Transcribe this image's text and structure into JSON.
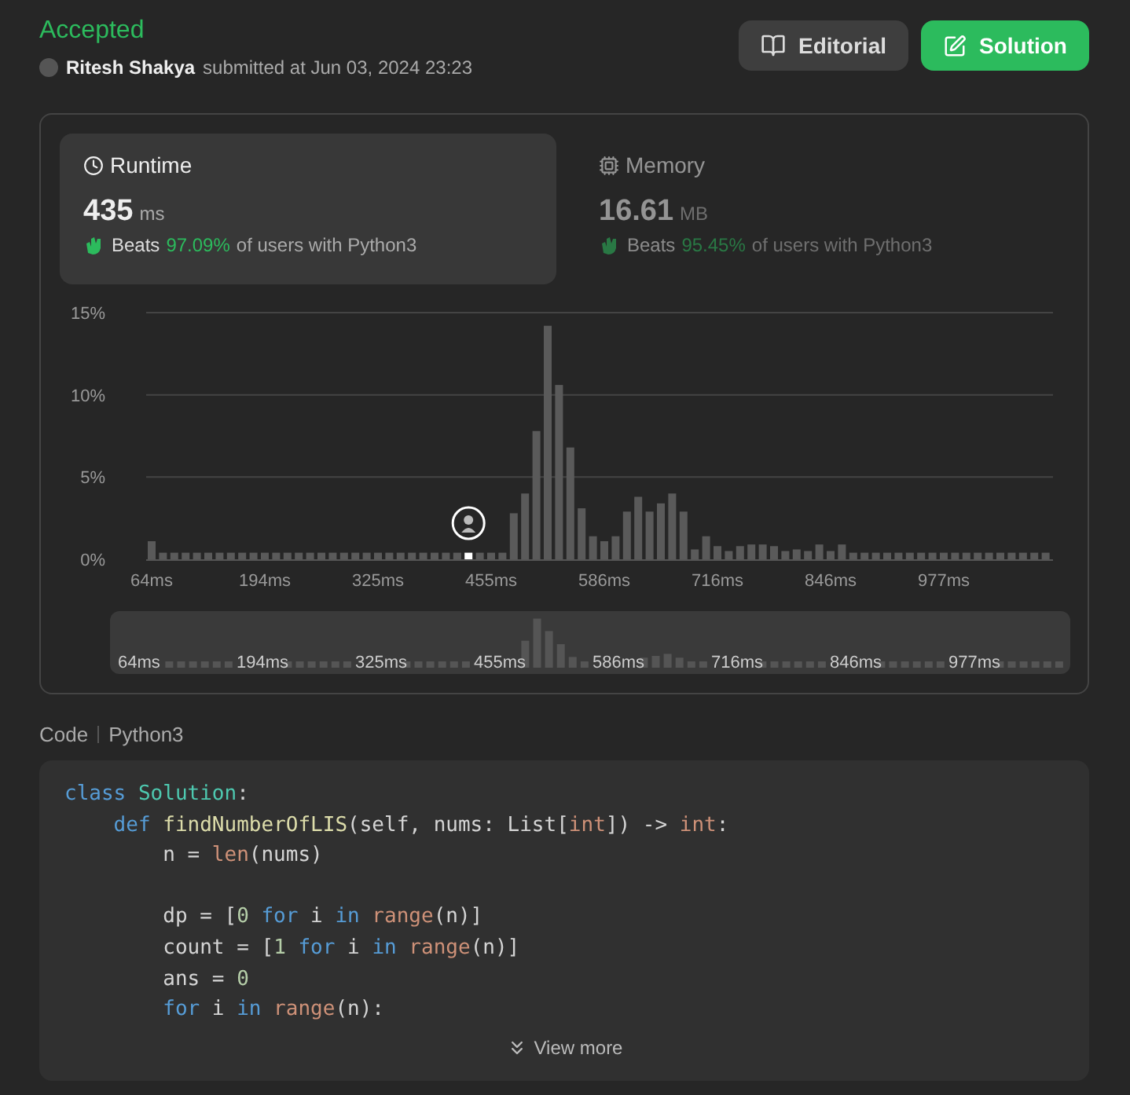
{
  "status": "Accepted",
  "submission": {
    "user": "Ritesh Shakya",
    "submitted": "submitted at Jun 03, 2024 23:23"
  },
  "buttons": [
    {
      "label": "Editorial",
      "kind": "secondary"
    },
    {
      "label": "Solution",
      "kind": "primary"
    }
  ],
  "stats": [
    {
      "title": "Runtime",
      "kind": "clock",
      "value": "435",
      "unit": "ms",
      "beats_label": "Beats",
      "beats": "97.09%",
      "suffix": "of users with Python3",
      "selected": true
    },
    {
      "title": "Memory",
      "kind": "chip",
      "value": "16.61",
      "unit": "MB",
      "beats_label": "Beats",
      "beats": "95.45%",
      "suffix": "of users with Python3",
      "selected": false
    }
  ],
  "chart": {
    "chart_data": {
      "type": "bar",
      "ylim": [
        0,
        15
      ],
      "yticks": [
        {
          "value": 0,
          "label": "0%"
        },
        {
          "value": 5,
          "label": "5%"
        },
        {
          "value": 10,
          "label": "10%"
        },
        {
          "value": 15,
          "label": "15%"
        }
      ],
      "categories": [
        "64ms",
        null,
        null,
        null,
        null,
        null,
        null,
        null,
        null,
        null,
        "194ms",
        null,
        null,
        null,
        null,
        null,
        null,
        null,
        null,
        null,
        "325ms",
        null,
        null,
        null,
        null,
        null,
        null,
        null,
        null,
        null,
        "455ms",
        null,
        null,
        null,
        null,
        null,
        null,
        null,
        null,
        null,
        "586ms",
        null,
        null,
        null,
        null,
        null,
        null,
        null,
        null,
        null,
        "716ms",
        null,
        null,
        null,
        null,
        null,
        null,
        null,
        null,
        null,
        "846ms",
        null,
        null,
        null,
        null,
        null,
        null,
        null,
        null,
        null,
        "977ms",
        null,
        null,
        null,
        null,
        null,
        null,
        null,
        null,
        null
      ],
      "series": [
        {
          "color": "#5a5a5a",
          "values": [
            1.1,
            0.4,
            0.4,
            0.4,
            0.4,
            0.4,
            0.4,
            0.4,
            0.4,
            0.4,
            0.4,
            0.4,
            0.4,
            0.4,
            0.4,
            0.4,
            0.4,
            0.4,
            0.4,
            0.4,
            0.4,
            0.4,
            0.4,
            0.4,
            0.4,
            0.4,
            0.4,
            0.4,
            null,
            0.4,
            0.4,
            0.4,
            2.8,
            4.0,
            7.8,
            14.2,
            10.6,
            6.8,
            3.1,
            1.4,
            1.1,
            1.4,
            2.9,
            3.8,
            2.9,
            3.4,
            4.0,
            2.9,
            0.6,
            1.4,
            0.8,
            0.5,
            0.8,
            0.9,
            0.9,
            0.8,
            0.5,
            0.6,
            0.5,
            0.9,
            0.5,
            0.9,
            0.4,
            0.4,
            0.4,
            0.4,
            0.4,
            0.4,
            0.4,
            0.4,
            0.4,
            0.4,
            0.4,
            0.4,
            0.4,
            0.4,
            0.4,
            0.4,
            0.4,
            0.4
          ]
        },
        {
          "color": "#ffffff",
          "values": [
            null,
            null,
            null,
            null,
            null,
            null,
            null,
            null,
            null,
            null,
            null,
            null,
            null,
            null,
            null,
            null,
            null,
            null,
            null,
            null,
            null,
            null,
            null,
            null,
            null,
            null,
            null,
            null,
            0.4,
            null,
            null,
            null,
            null,
            null,
            null,
            null,
            null,
            null,
            null,
            null,
            null,
            null,
            null,
            null,
            null,
            null,
            null,
            null,
            null,
            null,
            null,
            null,
            null,
            null,
            null,
            null,
            null,
            null,
            null,
            null,
            null,
            null,
            null,
            null,
            null,
            null,
            null,
            null,
            null,
            null,
            null,
            null,
            null,
            null,
            null,
            null,
            null,
            null,
            null,
            null
          ]
        }
      ]
    },
    "navigator": {
      "labels": [
        "64ms",
        "194ms",
        "325ms",
        "455ms",
        "586ms",
        "716ms",
        "846ms",
        "977ms"
      ]
    }
  },
  "code": {
    "label": "Code",
    "language": "Python3",
    "lines": [
      {
        "tokens": [
          {
            "kind": "keyword",
            "text": "class "
          },
          {
            "kind": "class",
            "text": "Solution"
          },
          {
            "kind": "plain",
            "text": ":"
          }
        ]
      },
      {
        "tokens": [
          {
            "kind": "keyword",
            "text": "    def "
          },
          {
            "kind": "func",
            "text": "findNumberOfLIS"
          },
          {
            "kind": "plain",
            "text": "(self, nums: List["
          },
          {
            "kind": "builtin",
            "text": "int"
          },
          {
            "kind": "plain",
            "text": "]) -> "
          },
          {
            "kind": "builtin",
            "text": "int"
          },
          {
            "kind": "plain",
            "text": ":"
          }
        ]
      },
      {
        "tokens": [
          {
            "kind": "plain",
            "text": "        n = "
          },
          {
            "kind": "builtin",
            "text": "len"
          },
          {
            "kind": "plain",
            "text": "(nums)"
          }
        ]
      },
      {
        "blank_before": true,
        "tokens": [
          {
            "kind": "plain",
            "text": "        dp = ["
          },
          {
            "kind": "number",
            "text": "0"
          },
          {
            "kind": "keyword",
            "text": " for"
          },
          {
            "kind": "plain",
            "text": " i "
          },
          {
            "kind": "keyword",
            "text": "in"
          },
          {
            "kind": "builtin",
            "text": " range"
          },
          {
            "kind": "plain",
            "text": "(n)]"
          }
        ]
      },
      {
        "tokens": [
          {
            "kind": "plain",
            "text": "        count = ["
          },
          {
            "kind": "number",
            "text": "1"
          },
          {
            "kind": "keyword",
            "text": " for"
          },
          {
            "kind": "plain",
            "text": " i "
          },
          {
            "kind": "keyword",
            "text": "in"
          },
          {
            "kind": "builtin",
            "text": " range"
          },
          {
            "kind": "plain",
            "text": "(n)]"
          }
        ]
      },
      {
        "tokens": [
          {
            "kind": "plain",
            "text": "        ans = "
          },
          {
            "kind": "number",
            "text": "0"
          }
        ]
      },
      {
        "tokens": [
          {
            "kind": "keyword",
            "text": "        for"
          },
          {
            "kind": "plain",
            "text": " i "
          },
          {
            "kind": "keyword",
            "text": "in"
          },
          {
            "kind": "builtin",
            "text": " range"
          },
          {
            "kind": "plain",
            "text": "(n):"
          }
        ]
      }
    ],
    "more": "View more"
  }
}
